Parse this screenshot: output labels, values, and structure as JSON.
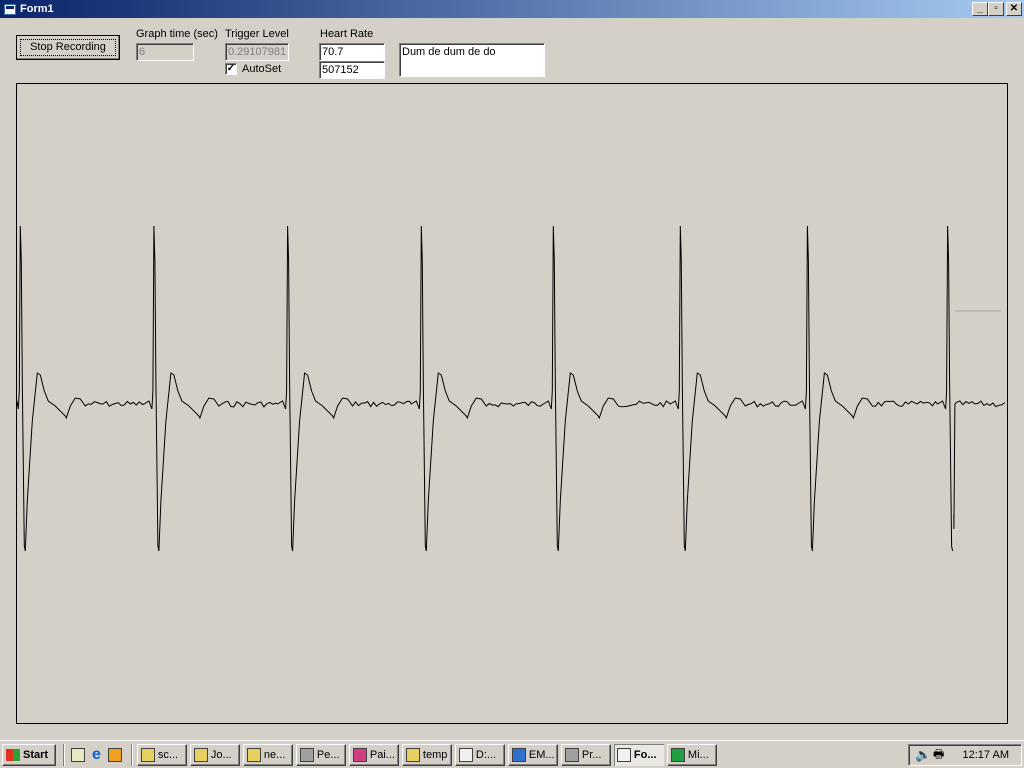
{
  "window": {
    "title": "Form1",
    "minimize": "_",
    "restore": "▫",
    "close": "✕"
  },
  "controls": {
    "stop_button": "Stop Recording",
    "graph_time_label": "Graph time (sec)",
    "graph_time_value": "6",
    "trigger_label": "Trigger Level",
    "trigger_value": "0.29107981",
    "autoset_label": "AutoSet",
    "autoset_checked": true,
    "heart_rate_label": "Heart Rate",
    "heart_rate_value": "70.7",
    "counter_value": "507152",
    "message_text": "Dum de dum de do"
  },
  "trace": {
    "graph_seconds": 6,
    "beat_times_sec": [
      0.02,
      0.83,
      1.64,
      2.45,
      3.25,
      4.02,
      4.79,
      5.64
    ],
    "sweep_position_sec": 5.66
  },
  "taskbar": {
    "start": "Start",
    "items": [
      {
        "label": "sc...",
        "icon": "search-icon"
      },
      {
        "label": "Jo...",
        "icon": "search-icon"
      },
      {
        "label": "ne...",
        "icon": "search-icon"
      },
      {
        "label": "Pe...",
        "icon": "app-icon"
      },
      {
        "label": "Pai...",
        "icon": "paint-icon"
      },
      {
        "label": "temp",
        "icon": "search-icon"
      },
      {
        "label": "D:...",
        "icon": "chart-icon"
      },
      {
        "label": "EM...",
        "icon": "ie-icon"
      },
      {
        "label": "Pr...",
        "icon": "app-icon"
      },
      {
        "label": "Fo...",
        "icon": "form-icon",
        "active": true
      },
      {
        "label": "Mi...",
        "icon": "excel-icon"
      }
    ],
    "clock": "12:17 AM"
  }
}
